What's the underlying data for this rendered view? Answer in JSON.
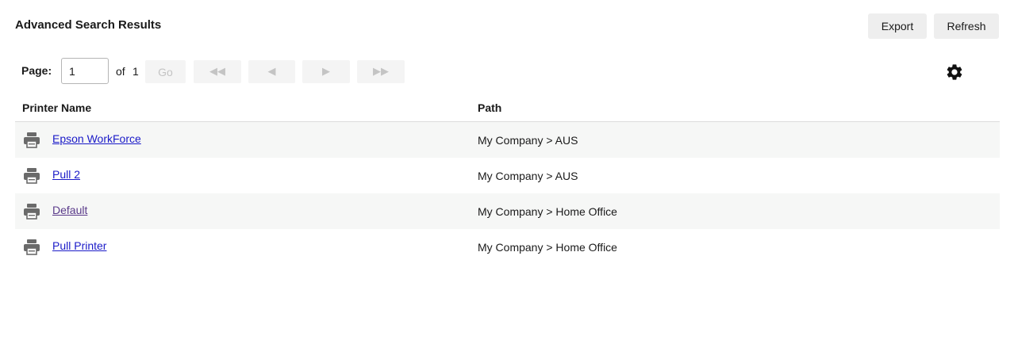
{
  "header": {
    "title": "Advanced Search Results",
    "export_label": "Export",
    "refresh_label": "Refresh"
  },
  "pager": {
    "page_label": "Page:",
    "current_page": "1",
    "of_label": "of",
    "total_pages": "1",
    "go_label": "Go",
    "first_symbol": "◀◀",
    "prev_symbol": "◀",
    "next_symbol": "▶",
    "last_symbol": "▶▶"
  },
  "settings_icon": "gear-icon",
  "table": {
    "columns": [
      "Printer Name",
      "Path"
    ],
    "rows": [
      {
        "name": "Epson WorkForce",
        "path": "My Company > AUS",
        "icon": "printer-icon"
      },
      {
        "name": "Pull 2",
        "path": "My Company > AUS",
        "icon": "printer-icon"
      },
      {
        "name": "Default",
        "path": "My Company > Home Office",
        "icon": "printer-icon"
      },
      {
        "name": "Pull Printer",
        "path": "My Company > Home Office",
        "icon": "printer-icon"
      }
    ]
  },
  "colors": {
    "link": "#1a1ac8",
    "visited_link": "#5a3a8a",
    "row_shade": "#f6f7f6",
    "button_bg": "#eeeeee"
  }
}
